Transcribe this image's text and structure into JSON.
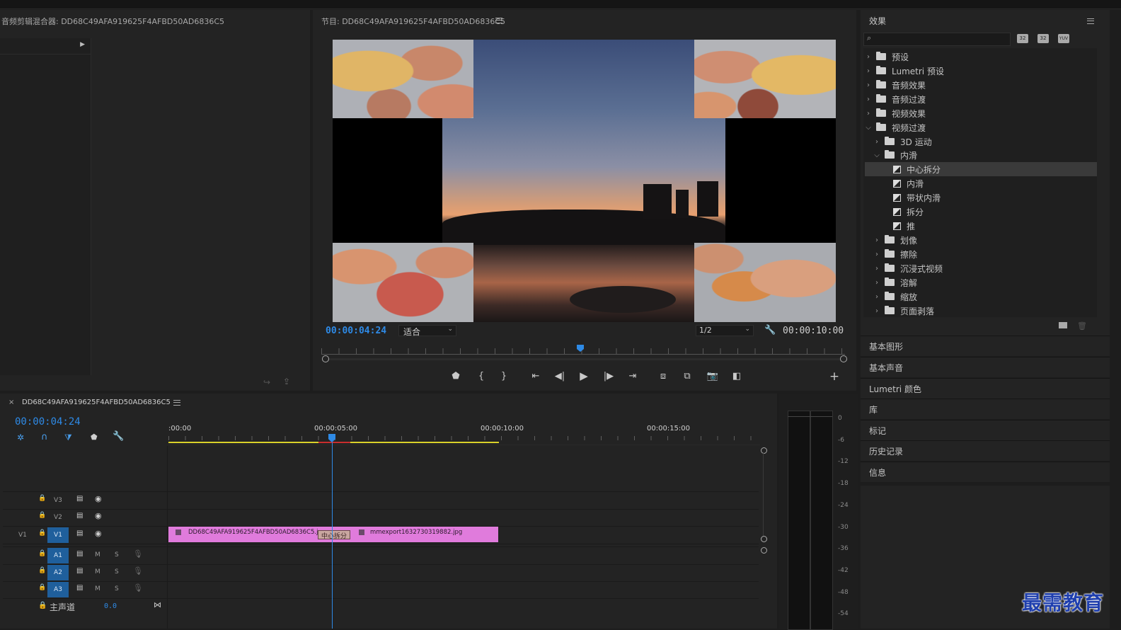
{
  "audio_mixer": {
    "title": "音频剪辑混合器: DD68C49AFA919625F4AFBD50AD6836C5"
  },
  "program": {
    "title": "节目: DD68C49AFA919625F4AFBD50AD6836C5",
    "current_time": "00:00:04:24",
    "fit_option": "适合",
    "resolution": "1/2",
    "duration": "00:00:10:00",
    "playhead_fraction": 0.495
  },
  "effects": {
    "title": "效果",
    "search_placeholder": "",
    "tree": [
      {
        "label": "预设",
        "level": 0,
        "type": "folder-special",
        "expanded": false
      },
      {
        "label": "Lumetri 预设",
        "level": 0,
        "type": "folder-special",
        "expanded": false
      },
      {
        "label": "音频效果",
        "level": 0,
        "type": "folder",
        "expanded": false
      },
      {
        "label": "音频过渡",
        "level": 0,
        "type": "folder",
        "expanded": false
      },
      {
        "label": "视频效果",
        "level": 0,
        "type": "folder",
        "expanded": false
      },
      {
        "label": "视频过渡",
        "level": 0,
        "type": "folder",
        "expanded": true
      },
      {
        "label": "3D 运动",
        "level": 1,
        "type": "folder",
        "expanded": false
      },
      {
        "label": "内滑",
        "level": 1,
        "type": "folder",
        "expanded": true
      },
      {
        "label": "中心拆分",
        "level": 2,
        "type": "effect",
        "selected": true
      },
      {
        "label": "内滑",
        "level": 2,
        "type": "effect"
      },
      {
        "label": "带状内滑",
        "level": 2,
        "type": "effect"
      },
      {
        "label": "拆分",
        "level": 2,
        "type": "effect"
      },
      {
        "label": "推",
        "level": 2,
        "type": "effect"
      },
      {
        "label": "划像",
        "level": 1,
        "type": "folder",
        "expanded": false
      },
      {
        "label": "擦除",
        "level": 1,
        "type": "folder",
        "expanded": false
      },
      {
        "label": "沉浸式视频",
        "level": 1,
        "type": "folder",
        "expanded": false
      },
      {
        "label": "溶解",
        "level": 1,
        "type": "folder",
        "expanded": false
      },
      {
        "label": "缩放",
        "level": 1,
        "type": "folder",
        "expanded": false
      },
      {
        "label": "页面剥落",
        "level": 1,
        "type": "folder",
        "expanded": false
      }
    ],
    "bin_icons": [
      "32",
      "32",
      "YUV"
    ]
  },
  "side_panels": [
    "基本图形",
    "基本声音",
    "Lumetri 颜色",
    "库",
    "标记",
    "历史记录",
    "信息"
  ],
  "timeline": {
    "tab_close": "×",
    "sequence_name": "DD68C49AFA919625F4AFBD50AD6836C5",
    "current_time": "00:00:04:24",
    "ruler_labels": [
      ":00:00",
      "00:00:05:00",
      "00:00:10:00",
      "00:00:15:00"
    ],
    "video_tracks": [
      {
        "name": "V3",
        "source": ""
      },
      {
        "name": "V2",
        "source": ""
      },
      {
        "name": "V1",
        "source": "V1"
      }
    ],
    "audio_tracks": [
      {
        "name": "A1",
        "m": "M",
        "s": "S"
      },
      {
        "name": "A2",
        "m": "M",
        "s": "S"
      },
      {
        "name": "A3",
        "m": "M",
        "s": "S"
      }
    ],
    "master": {
      "label": "主声道",
      "value": "0.0"
    },
    "clips": [
      {
        "name": "DD68C49AFA919625F4AFBD50AD6836C5.jp",
        "color": "#e07bdc"
      },
      {
        "name": "mmexport1632730319882.jpg",
        "color": "#e07bdc"
      }
    ],
    "transition_label": "中心拆分"
  },
  "meter": {
    "labels": [
      "0",
      "-6",
      "-12",
      "-18",
      "-24",
      "-30",
      "-36",
      "-42",
      "-48",
      "-54"
    ]
  },
  "watermark": "最需教育",
  "colors": {
    "accent_blue": "#2e8ae6",
    "clip_pink": "#e07bdc",
    "track_badge": "#1f5f9c",
    "workarea_yellow": "#d9d12a"
  }
}
